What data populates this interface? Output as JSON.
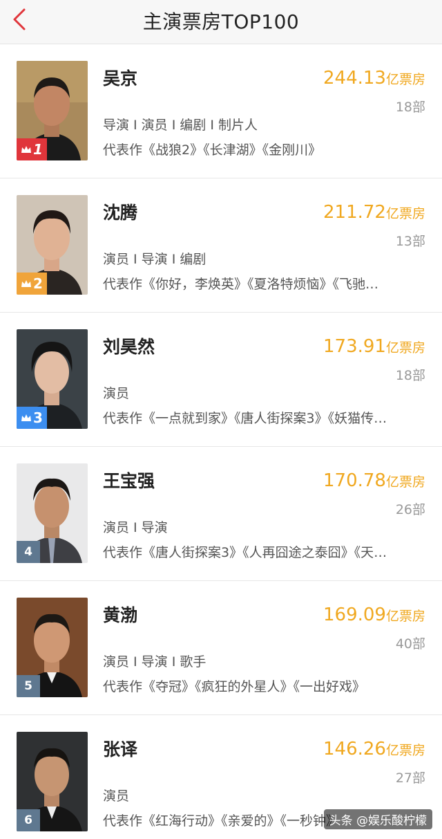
{
  "header": {
    "title": "主演票房TOP100"
  },
  "colors": {
    "accent": "#f0a820",
    "rank1": "#e0353b",
    "rank2": "#f0a43a",
    "rank3": "#3c8ef0",
    "rank_plain": "#5f7890"
  },
  "items": [
    {
      "rank": "1",
      "name": "吴京",
      "box_value": "244.13",
      "box_unit": "亿票房",
      "count": "18部",
      "roles": "导演 I 演员 I 编剧 I 制片人",
      "works": "代表作《战狼2》《长津湖》《金刚川》"
    },
    {
      "rank": "2",
      "name": "沈腾",
      "box_value": "211.72",
      "box_unit": "亿票房",
      "count": "13部",
      "roles": "演员 I 导演 I 编剧",
      "works": "代表作《你好，李焕英》《夏洛特烦恼》《飞驰…"
    },
    {
      "rank": "3",
      "name": "刘昊然",
      "box_value": "173.91",
      "box_unit": "亿票房",
      "count": "18部",
      "roles": "演员",
      "works": "代表作《一点就到家》《唐人街探案3》《妖猫传…"
    },
    {
      "rank": "4",
      "name": "王宝强",
      "box_value": "170.78",
      "box_unit": "亿票房",
      "count": "26部",
      "roles": "演员 I 导演",
      "works": "代表作《唐人街探案3》《人再囧途之泰囧》《天…"
    },
    {
      "rank": "5",
      "name": "黄渤",
      "box_value": "169.09",
      "box_unit": "亿票房",
      "count": "40部",
      "roles": "演员 I 导演 I 歌手",
      "works": "代表作《夺冠》《疯狂的外星人》《一出好戏》"
    },
    {
      "rank": "6",
      "name": "张译",
      "box_value": "146.26",
      "box_unit": "亿票房",
      "count": "27部",
      "roles": "演员",
      "works": "代表作《红海行动》《亲爱的》《一秒钟》"
    }
  ],
  "watermark": "头条 @娱乐酸柠檬"
}
